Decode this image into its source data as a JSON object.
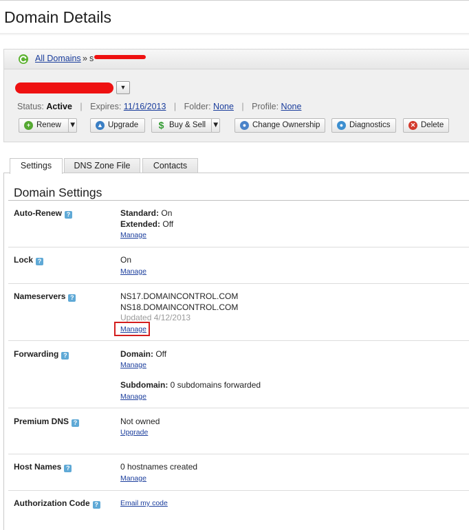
{
  "page": {
    "title": "Domain Details"
  },
  "breadcrumb": {
    "root": "All Domains",
    "separator": "»",
    "current": "s"
  },
  "domain": {
    "name": ""
  },
  "status": {
    "status_label": "Status:",
    "status_value": "Active",
    "expires_label": "Expires:",
    "expires_value": "11/16/2013",
    "folder_label": "Folder:",
    "folder_value": "None",
    "profile_label": "Profile:",
    "profile_value": "None",
    "separator": "|"
  },
  "toolbar": {
    "renew": "Renew",
    "upgrade": "Upgrade",
    "buy_sell": "Buy & Sell",
    "change_ownership": "Change Ownership",
    "diagnostics": "Diagnostics",
    "delete": "Delete"
  },
  "tabs": [
    {
      "label": "Settings",
      "active": true
    },
    {
      "label": "DNS Zone File",
      "active": false
    },
    {
      "label": "Contacts",
      "active": false
    }
  ],
  "settings": {
    "title": "Domain Settings",
    "help_glyph": "?",
    "auto_renew": {
      "label": "Auto-Renew",
      "standard_label": "Standard:",
      "standard_value": "On",
      "extended_label": "Extended:",
      "extended_value": "Off",
      "link": "Manage"
    },
    "lock": {
      "label": "Lock",
      "value": "On",
      "link": "Manage"
    },
    "nameservers": {
      "label": "Nameservers",
      "ns1": "NS17.DOMAINCONTROL.COM",
      "ns2": "NS18.DOMAINCONTROL.COM",
      "updated": "Updated 4/12/2013",
      "link": "Manage"
    },
    "forwarding": {
      "label": "Forwarding",
      "domain_label": "Domain:",
      "domain_value": "Off",
      "domain_link": "Manage",
      "subdomain_label": "Subdomain:",
      "subdomain_value": "0 subdomains forwarded",
      "subdomain_link": "Manage"
    },
    "premium_dns": {
      "label": "Premium DNS",
      "value": "Not owned",
      "link": "Upgrade"
    },
    "host_names": {
      "label": "Host Names",
      "value": "0 hostnames created",
      "link": "Manage"
    },
    "auth_code": {
      "label": "Authorization Code",
      "link": "Email my code"
    }
  },
  "colors": {
    "link": "#1a3d9c",
    "redaction": "#ee1111",
    "highlight": "#d31d1d",
    "help_icon": "#5fa9d6"
  }
}
